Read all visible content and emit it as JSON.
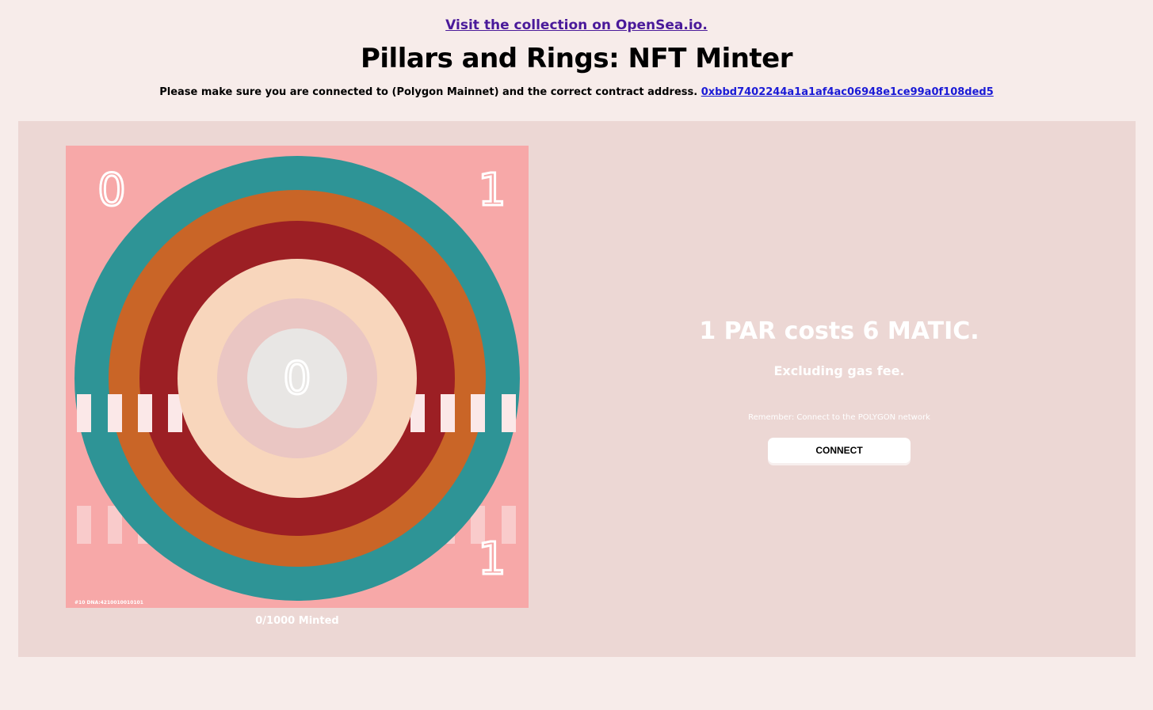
{
  "header": {
    "opensea_link": "Visit the collection on OpenSea.io.",
    "title": "Pillars and Rings: NFT Minter",
    "notice": "Please make sure you are connected to (Polygon Mainnet) and the correct contract address.",
    "contract_address": "0xbbd7402244a1a1af4ac06948e1ce99a0f108ded5"
  },
  "nft": {
    "corner_top_left": "0",
    "corner_top_right": "1",
    "corner_bottom_right": "1",
    "center_digit": "0",
    "dna_label": "#10 DNA:4210010010101",
    "colors": {
      "background": "#f7a8a8",
      "ring_teal": "#2e9496",
      "ring_orange": "#c96527",
      "ring_red": "#9c1f24",
      "ring_peach": "#f8d6bc",
      "ring_pink": "#eac6c3",
      "core_grey": "#e8e6e4",
      "pillar": "#fbe8e8"
    }
  },
  "mint": {
    "minted_count": "0/1000 Minted",
    "cost": "1 PAR costs 6 MATIC.",
    "gas_note": "Excluding gas fee.",
    "network_note": "Remember: Connect to the POLYGON network",
    "connect_label": "CONNECT"
  }
}
